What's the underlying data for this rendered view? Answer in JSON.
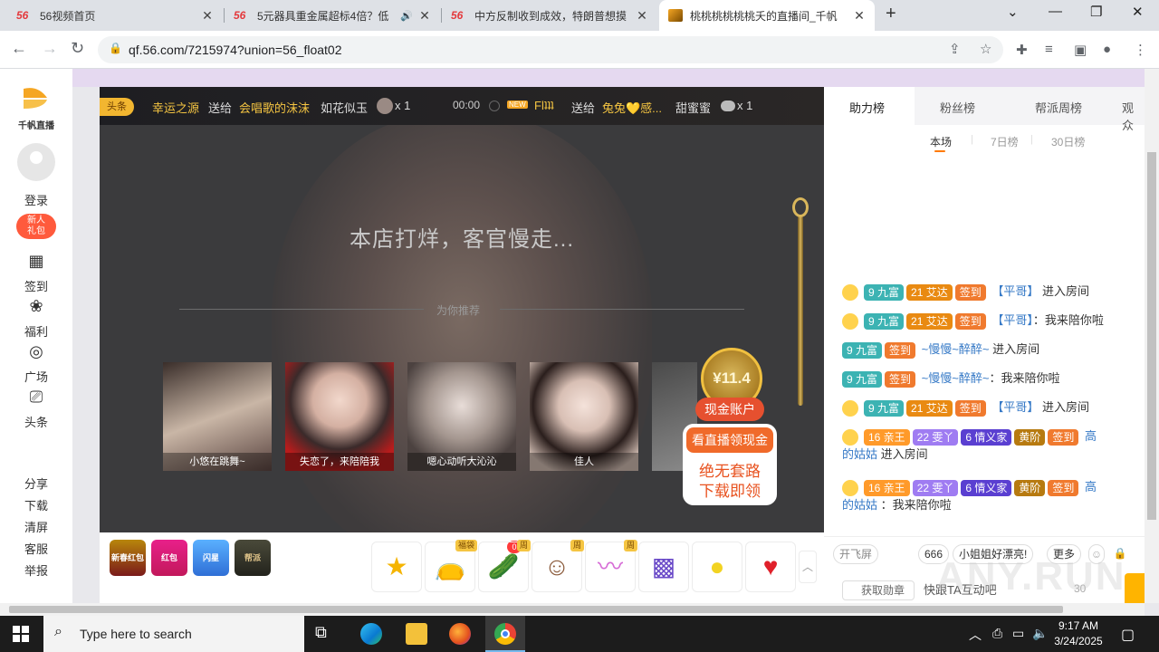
{
  "browser": {
    "tabs": [
      {
        "favicon": "56",
        "title": "56视频首页"
      },
      {
        "favicon": "56",
        "title": "5元器具重金属超标4倍？低"
      },
      {
        "favicon": "56",
        "title": "中方反制收到成效，特朗普想摸"
      },
      {
        "title": "桃桃桃桃桃桃夭的直播间_千帆"
      }
    ],
    "url": "qf.56.com/7215974?union=56_float02"
  },
  "left_sidebar": {
    "logo_text": "千帆直播",
    "login": "登录",
    "new_badge": [
      "新人",
      "礼包"
    ],
    "items": [
      "签到",
      "福利",
      "广场",
      "头条"
    ],
    "bottom_links": [
      "分享",
      "下载",
      "清屏",
      "客服",
      "举报"
    ]
  },
  "player": {
    "headline": {
      "badge": "头条",
      "left": {
        "sender": "幸运之源",
        "action": "送给",
        "receiver": "会唱歌的沫沫",
        "gift": "如花似玉",
        "count": "x 1"
      },
      "time": "00:00",
      "new_tag": "NEW",
      "right": {
        "sender": "Flʇʇʇ",
        "action": "送给",
        "receiver": "兔兔💛感...",
        "gift": "甜蜜蜜",
        "count": "x 1"
      }
    },
    "offline_text": "本店打烊，客官慢走...",
    "recommend_title": "为你推荐",
    "recommendations": [
      "小悠在跳舞~",
      "失恋了，来陪陪我",
      "嗯心动听大沁沁",
      "佳人"
    ],
    "cash": {
      "amount": "¥11.4",
      "label": "现金账户",
      "button": "看直播领现金",
      "line1": "绝无套路",
      "line2": "下载即领"
    }
  },
  "bottom_bar": {
    "activities": [
      "新春红包",
      "红包",
      "闪星",
      "帮派"
    ],
    "gift_count": "0",
    "gift_tags": [
      "福袋",
      "周",
      "周",
      "周"
    ],
    "gift_icons": [
      "star-gift-icon",
      "lucky-bag-icon",
      "cucumber-icon",
      "girl-gift-icon",
      "wing-gift-icon",
      "treasure-box-icon",
      "lemon-icon",
      "love-heart-icon"
    ]
  },
  "right_panel": {
    "tabs": [
      "助力榜",
      "粉丝榜",
      "帮派周榜",
      "观众"
    ],
    "sub_tabs": [
      "本场",
      "7日榜",
      "30日榜"
    ],
    "chat": [
      {
        "level": "9 九富",
        "badges": [
          "21 艾达",
          "签到"
        ],
        "name": "【平哥】",
        "text": "进入房间"
      },
      {
        "level": "9 九富",
        "badges": [
          "21 艾达",
          "签到"
        ],
        "name": "【平哥】",
        "text": "：我来陪你啦"
      },
      {
        "level": "9 九富",
        "badges": [
          "签到"
        ],
        "name": "~慢慢~醉醉~",
        "text": "进入房间"
      },
      {
        "level": "9 九富",
        "badges": [
          "签到"
        ],
        "name": "~慢慢~醉醉~",
        "text": "：我来陪你啦"
      },
      {
        "level": "9 九富",
        "badges": [
          "21 艾达",
          "签到"
        ],
        "name": "【平哥】",
        "text": "进入房间"
      },
      {
        "level": "16 亲王",
        "badges": [
          "22 雯丫",
          "6 情义家",
          "黄阶",
          "签到"
        ],
        "name_part1": "高",
        "name_part2": "的姑姑",
        "text": "进入房间"
      },
      {
        "level": "16 亲王",
        "badges": [
          "22 雯丫",
          "6 情义家",
          "黄阶",
          "签到"
        ],
        "name_part1": "高",
        "name_part2": "的姑姑",
        "text": "：我来陪你啦"
      }
    ],
    "quick_pills": [
      "开飞屏",
      "666",
      "小姐姐好漂亮!",
      "更多"
    ],
    "medal_button": "获取勋章",
    "input_placeholder": "快跟TA互动吧",
    "input_count": "30"
  },
  "taskbar": {
    "search_placeholder": "Type here to search",
    "time": "9:17 AM",
    "date": "3/24/2025"
  },
  "watermark": "ANY.RUN",
  "colors": {
    "accent": "#f06a2a",
    "gold": "#f2b630",
    "teal_badge": "#3cb3b3",
    "link": "#3478c6"
  }
}
